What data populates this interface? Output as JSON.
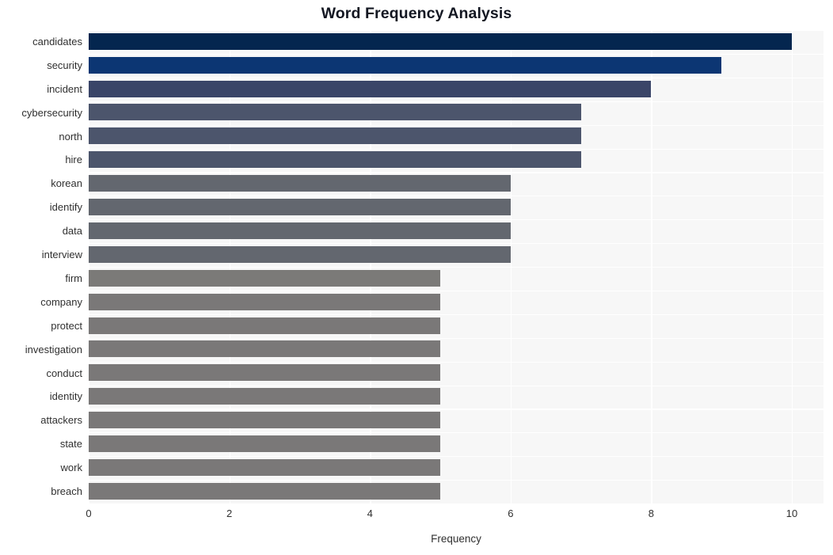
{
  "chart_data": {
    "type": "bar",
    "orientation": "horizontal",
    "title": "Word Frequency Analysis",
    "xlabel": "Frequency",
    "ylabel": "",
    "xlim": [
      0,
      10.45
    ],
    "xticks": [
      0,
      2,
      4,
      6,
      8,
      10
    ],
    "xtick_labels": [
      "0",
      "2",
      "4",
      "6",
      "8",
      "10"
    ],
    "grid": true,
    "legend": null,
    "categories": [
      "candidates",
      "security",
      "incident",
      "cybersecurity",
      "north",
      "hire",
      "korean",
      "identify",
      "data",
      "interview",
      "firm",
      "company",
      "protect",
      "investigation",
      "conduct",
      "identity",
      "attackers",
      "state",
      "work",
      "breach"
    ],
    "values": [
      10,
      9,
      8,
      7,
      7,
      7,
      6,
      6,
      6,
      6,
      5,
      5,
      5,
      5,
      5,
      5,
      5,
      5,
      5,
      5
    ],
    "bar_colors": [
      "#04264f",
      "#0c3673",
      "#3a4568",
      "#4c556c",
      "#4c556c",
      "#4c556c",
      "#63676f",
      "#63676f",
      "#63676f",
      "#63676f",
      "#7b7a78",
      "#7a7878",
      "#7a7878",
      "#7a7878",
      "#7a7878",
      "#7a7878",
      "#7a7878",
      "#7a7878",
      "#7a7878",
      "#7a7878"
    ],
    "plot_background": "#f7f7f7",
    "grid_color": "#ffffff",
    "figure_background": "#ffffff"
  }
}
